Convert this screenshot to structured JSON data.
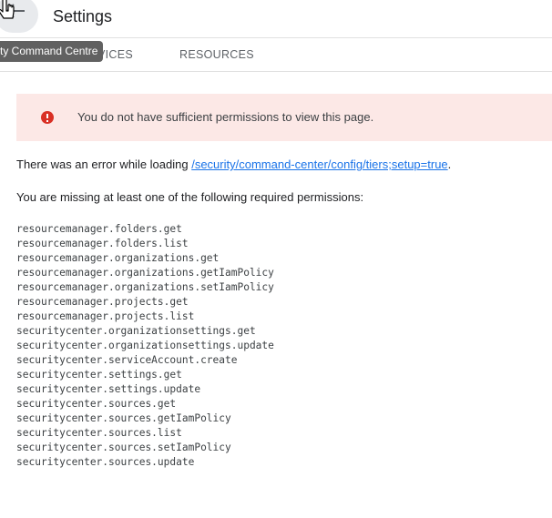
{
  "header": {
    "title": "Settings",
    "back_icon": "arrow-back-icon"
  },
  "tabs": {
    "items": [
      {
        "label": "VICES"
      },
      {
        "label": "RESOURCES"
      }
    ],
    "tooltip": "ty Command Centre"
  },
  "banner": {
    "icon": "error-icon",
    "color": "#d93025",
    "background": "#fce8e6",
    "text": "You do not have sufficient permissions to view this page."
  },
  "error": {
    "prefix": "There was an error while loading ",
    "link": "/security/command-center/config/tiers;setup=true",
    "suffix": ".",
    "missing_text": "You are missing at least one of the following required permissions:"
  },
  "permissions": [
    "resourcemanager.folders.get",
    "resourcemanager.folders.list",
    "resourcemanager.organizations.get",
    "resourcemanager.organizations.getIamPolicy",
    "resourcemanager.organizations.setIamPolicy",
    "resourcemanager.projects.get",
    "resourcemanager.projects.list",
    "securitycenter.organizationsettings.get",
    "securitycenter.organizationsettings.update",
    "securitycenter.serviceAccount.create",
    "securitycenter.settings.get",
    "securitycenter.settings.update",
    "securitycenter.sources.get",
    "securitycenter.sources.getIamPolicy",
    "securitycenter.sources.list",
    "securitycenter.sources.setIamPolicy",
    "securitycenter.sources.update"
  ]
}
